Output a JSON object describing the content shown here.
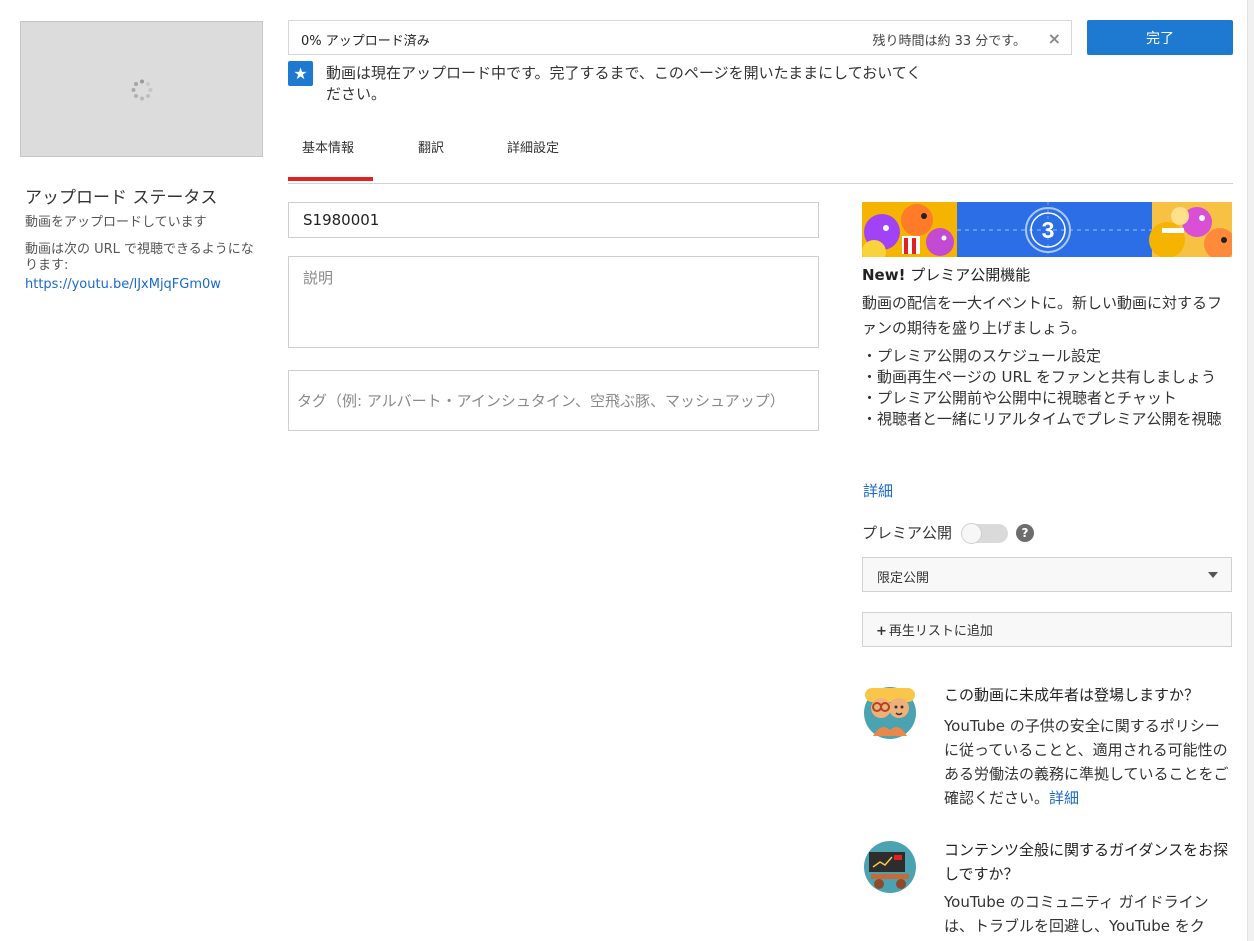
{
  "left_panel": {
    "status_title": "アップロード ステータス",
    "status_text": "動画をアップロードしています",
    "url_note": "動画は次の URL で視聴できるようになります:",
    "url": "https://youtu.be/lJxMjqFGm0w"
  },
  "upload": {
    "progress_label": "0% アップロード済み",
    "progress_percent": 0,
    "time_remaining": "残り時間は約 33 分です。",
    "close_symbol": "×",
    "done_label": "完了",
    "notice": "動画は現在アップロード中です。完了するまで、このページを開いたままにしておいてください。"
  },
  "tabs": [
    {
      "label": "基本情報",
      "active": true
    },
    {
      "label": "翻訳",
      "active": false
    },
    {
      "label": "詳細設定",
      "active": false
    }
  ],
  "form": {
    "title_value": "S1980001",
    "description_placeholder": "説明",
    "tags_placeholder": "タグ（例: アルバート・アインシュタイン、空飛ぶ豚、マッシュアップ）"
  },
  "premiere": {
    "banner_number": "3",
    "heading_new": "New!",
    "heading_rest": " プレミア公開機能",
    "description": "動画の配信を一大イベントに。新しい動画に対するファンの期待を盛り上げましょう。",
    "features": [
      "・プレミア公開のスケジュール設定",
      "・動画再生ページの URL をファンと共有しましょう",
      "・プレミア公開前や公開中に視聴者とチャット",
      "・視聴者と一緒にリアルタイムでプレミア公開を視聴"
    ],
    "more_link": "詳細",
    "toggle_label": "プレミア公開",
    "toggle_on": false,
    "help_symbol": "?"
  },
  "visibility": {
    "selected": "限定公開"
  },
  "playlist": {
    "plus": "+",
    "label": "再生リストに追加"
  },
  "minors": {
    "title": "この動画に未成年者は登場しますか？",
    "body": "YouTube の子供の安全に関するポリシーに従っていることと、適用される可能性のある労働法の義務に準拠していることをご確認ください。",
    "link": "詳細"
  },
  "guidance": {
    "title": "コンテンツ全般に関するガイダンスをお探しですか？",
    "body": "YouTube のコミュニティ ガイドラインは、トラブルを回避し、YouTube をク"
  },
  "colors": {
    "accent_blue": "#1e7ad0",
    "tab_active_red": "#e12222",
    "link_blue": "#1a6ac8"
  }
}
